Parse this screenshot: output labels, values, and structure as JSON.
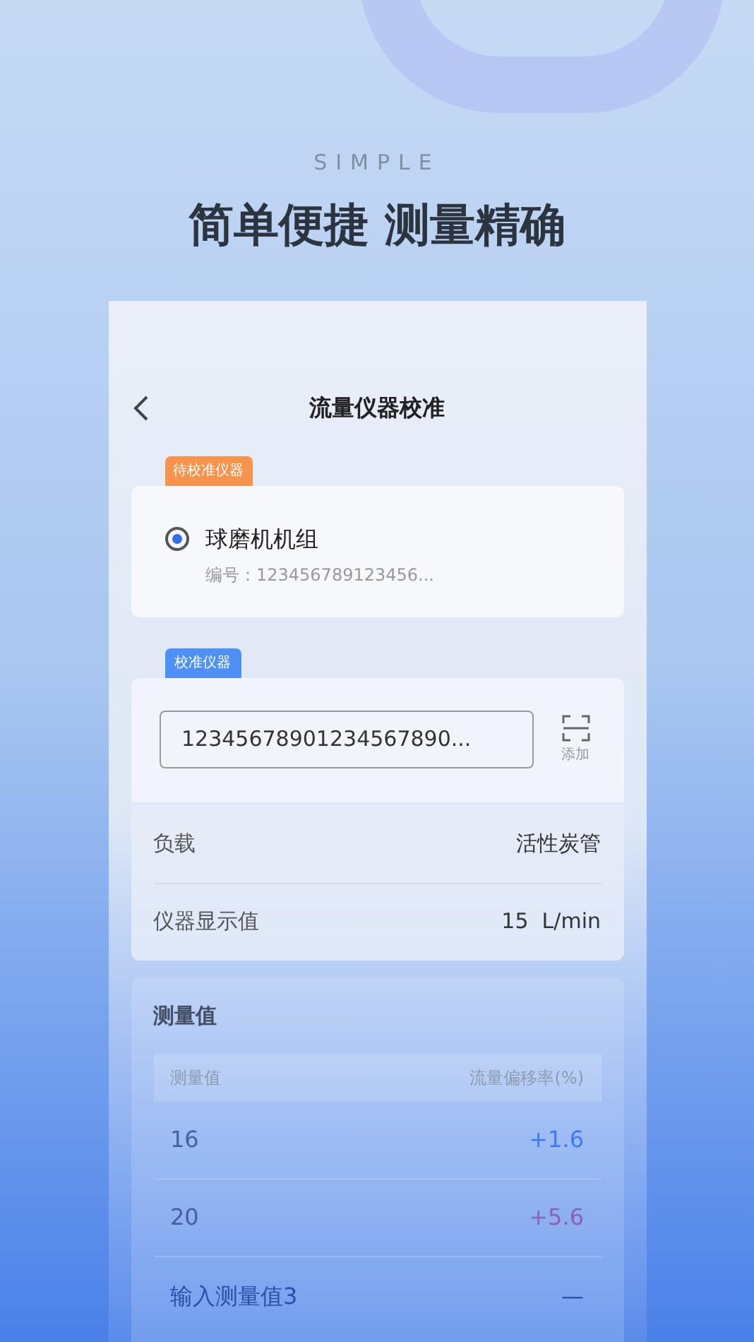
{
  "promo": {
    "eyebrow": "SIMPLE",
    "headline": "简单便捷 测量精确"
  },
  "screen": {
    "title": "流量仪器校准",
    "pending_instrument": {
      "tag": "待校准仪器",
      "name": "球磨机机组",
      "selected": true,
      "serial": "编号：123456789123456..."
    },
    "calibration_instrument": {
      "tag": "校准仪器",
      "value": "12345678901234567890...",
      "scan_label": "添加"
    },
    "details": [
      {
        "label": "负载",
        "value": "活性炭管"
      },
      {
        "label": "仪器显示值",
        "value": "15  L/min"
      }
    ],
    "measurements": {
      "title": "测量值",
      "columns": [
        "测量值",
        "流量偏移率(%)"
      ],
      "rows": [
        {
          "kind": "value",
          "value": "16",
          "deviation": "+1.6",
          "color": "#3b7cf0"
        },
        {
          "kind": "value",
          "value": "20",
          "deviation": "+5.6",
          "color": "#8a63b8"
        },
        {
          "kind": "placeholder",
          "value": "输入测量值3",
          "deviation": "—"
        }
      ]
    }
  }
}
